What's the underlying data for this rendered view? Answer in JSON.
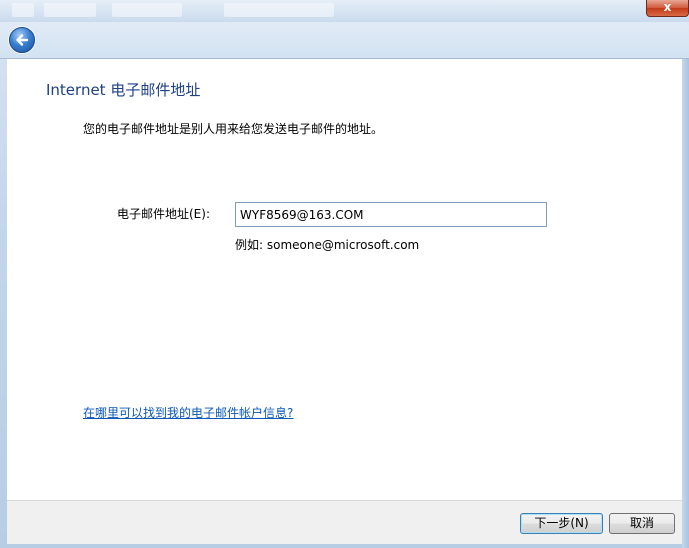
{
  "window": {
    "close_glyph": "x",
    "back_icon": "back-arrow-icon"
  },
  "page": {
    "title": "Internet 电子邮件地址",
    "description": "您的电子邮件地址是别人用来给您发送电子邮件的地址。"
  },
  "form": {
    "email_label": "电子邮件地址(E):",
    "email_value": "WYF8569@163.COM",
    "example": "例如: someone@microsoft.com"
  },
  "help_link": "在哪里可以找到我的电子邮件帐户信息?",
  "buttons": {
    "next": "下一步(N)",
    "cancel": "取消"
  },
  "colors": {
    "title": "#1e3f8a",
    "link": "#0b58b8",
    "close": "#c23a1a"
  }
}
